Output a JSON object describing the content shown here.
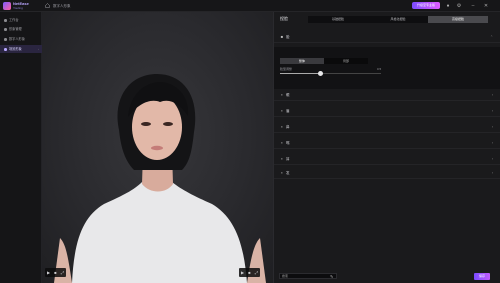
{
  "topbar": {
    "brand": "NetEase",
    "brand_sub": "Youling",
    "breadcrumb": "数字人形象",
    "upgrade_label": "升级至专业版",
    "icons": [
      "home-icon",
      "crown-icon",
      "bell-icon",
      "minimize-icon",
      "close-icon"
    ]
  },
  "sidebar": {
    "items": [
      {
        "label": "工作台",
        "icon": "grid-icon"
      },
      {
        "label": "形象管理",
        "icon": "user-icon"
      },
      {
        "label": "数字人形象",
        "icon": "face-icon"
      },
      {
        "label": "场景形象",
        "icon": "scene-icon"
      }
    ],
    "active_index": 3
  },
  "viewport": {
    "left_controls": [
      "▶",
      "■",
      "⤢"
    ],
    "right_controls": [
      "▶",
      "■",
      "⤢"
    ]
  },
  "panel": {
    "title": "捏脸",
    "tabs": [
      "基础捏脸",
      "风格化捏脸",
      "高级捏脸"
    ],
    "active_tab": 2,
    "sections": [
      {
        "label": "脸",
        "icon": "face-icon",
        "expanded": true
      },
      {
        "label": "眼",
        "icon": "eye-icon"
      },
      {
        "label": "眉",
        "icon": "brow-icon"
      },
      {
        "label": "鼻",
        "icon": "nose-icon"
      },
      {
        "label": "嘴",
        "icon": "mouth-icon"
      },
      {
        "label": "耳",
        "icon": "ear-icon"
      },
      {
        "label": "发",
        "icon": "hair-icon"
      }
    ],
    "expanded": {
      "segments": [
        "整体",
        "局部"
      ],
      "active_segment": 0,
      "slider_label": "脸型调整",
      "slider_value": "0.5",
      "slider_fraction": 0.4
    },
    "bottom_input_placeholder": "搜索",
    "apply_label": "保存"
  }
}
